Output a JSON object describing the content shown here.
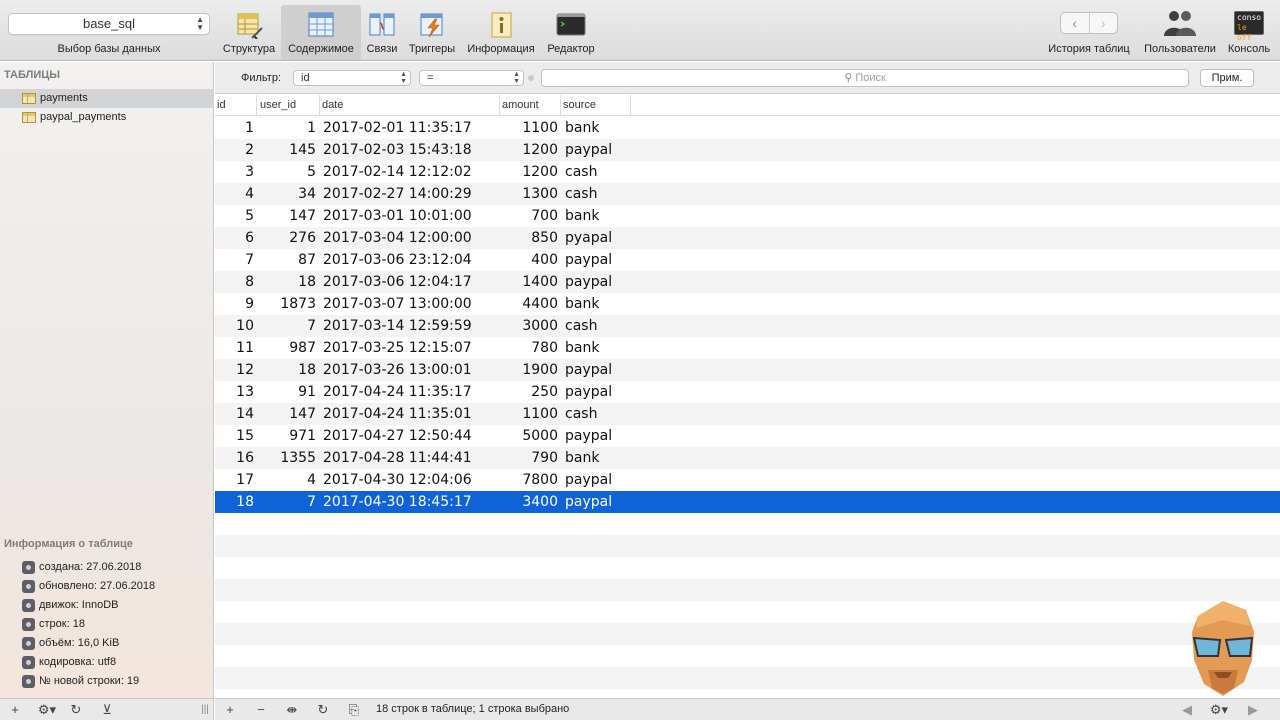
{
  "toolbar": {
    "database": "base_sql",
    "database_caption": "Выбор базы данных",
    "buttons": [
      {
        "label": "Структура",
        "icon": "structure-icon"
      },
      {
        "label": "Содержимое",
        "icon": "content-icon"
      },
      {
        "label": "Связи",
        "icon": "relations-icon"
      },
      {
        "label": "Триггеры",
        "icon": "triggers-icon"
      },
      {
        "label": "Информация",
        "icon": "info-icon"
      },
      {
        "label": "Редактор",
        "icon": "terminal-icon"
      }
    ],
    "right_buttons": [
      {
        "label": "История таблиц",
        "icon": "back-forward-icon"
      },
      {
        "label": "Пользователи",
        "icon": "users-icon"
      },
      {
        "label": "Консоль",
        "icon": "console-icon"
      }
    ],
    "console_logo_text": [
      "conso",
      "le off"
    ]
  },
  "sidebar": {
    "title": "ТАБЛИЦЫ",
    "tables": [
      "payments",
      "paypal_payments"
    ],
    "selected_table": "payments",
    "info_title": "Информация о таблице",
    "info": [
      "создана: 27.06.2018",
      "обновлено: 27.06.2018",
      "движок: InnoDB",
      "строк: 18",
      "объём: 16,0 KiB",
      "кодировка: utf8",
      "№ новой строки: 19"
    ]
  },
  "filter": {
    "label": "Фильтр:",
    "field": "id",
    "operator": "=",
    "search_placeholder": "Поиск",
    "apply_label": "Прим."
  },
  "table": {
    "columns": [
      "id",
      "user_id",
      "date",
      "amount",
      "source"
    ],
    "rows": [
      [
        "1",
        "1",
        "2017-02-01 11:35:17",
        "1100",
        "bank"
      ],
      [
        "2",
        "145",
        "2017-02-03 15:43:18",
        "1200",
        "paypal"
      ],
      [
        "3",
        "5",
        "2017-02-14 12:12:02",
        "1200",
        "cash"
      ],
      [
        "4",
        "34",
        "2017-02-27 14:00:29",
        "1300",
        "cash"
      ],
      [
        "5",
        "147",
        "2017-03-01 10:01:00",
        "700",
        "bank"
      ],
      [
        "6",
        "276",
        "2017-03-04 12:00:00",
        "850",
        "pyapal"
      ],
      [
        "7",
        "87",
        "2017-03-06 23:12:04",
        "400",
        "paypal"
      ],
      [
        "8",
        "18",
        "2017-03-06 12:04:17",
        "1400",
        "paypal"
      ],
      [
        "9",
        "1873",
        "2017-03-07 13:00:00",
        "4400",
        "bank"
      ],
      [
        "10",
        "7",
        "2017-03-14 12:59:59",
        "3000",
        "cash"
      ],
      [
        "11",
        "987",
        "2017-03-25 12:15:07",
        "780",
        "bank"
      ],
      [
        "12",
        "18",
        "2017-03-26 13:00:01",
        "1900",
        "paypal"
      ],
      [
        "13",
        "91",
        "2017-04-24 11:35:17",
        "250",
        "paypal"
      ],
      [
        "14",
        "147",
        "2017-04-24 11:35:01",
        "1100",
        "cash"
      ],
      [
        "15",
        "971",
        "2017-04-27 12:50:44",
        "5000",
        "paypal"
      ],
      [
        "16",
        "1355",
        "2017-04-28 11:44:41",
        "790",
        "bank"
      ],
      [
        "17",
        "4",
        "2017-04-30 12:04:06",
        "7800",
        "paypal"
      ],
      [
        "18",
        "7",
        "2017-04-30 18:45:17",
        "3400",
        "paypal"
      ]
    ],
    "selected_row": 18
  },
  "statusbar": {
    "text": "18 строк в таблице; 1 строка выбрано"
  },
  "colors": {
    "selection": "#0f63d8"
  }
}
